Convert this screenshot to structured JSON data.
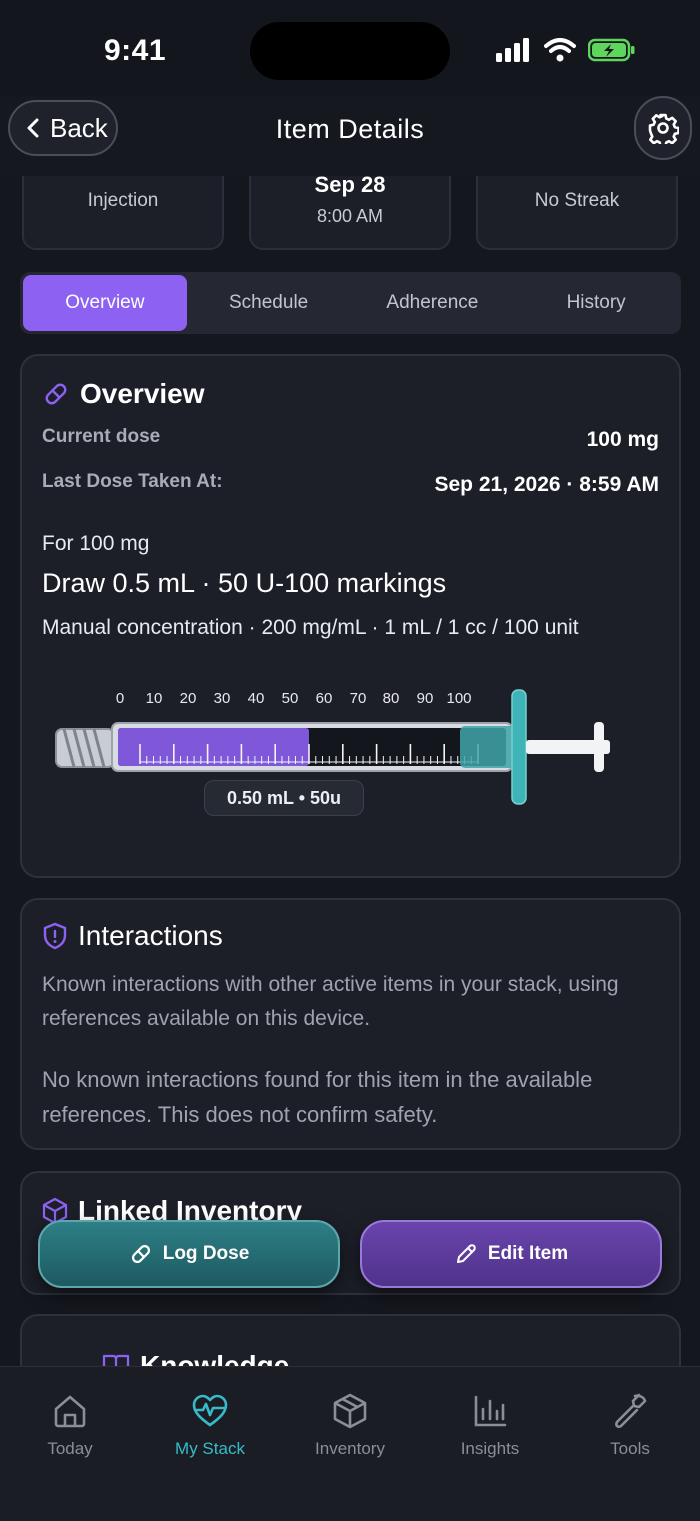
{
  "status_bar": {
    "time": "9:41"
  },
  "header": {
    "back_label": "Back",
    "title": "Item Details"
  },
  "stat_cards": [
    {
      "label": "Injection"
    },
    {
      "title": "Sep 28",
      "subtitle": "8:00 AM"
    },
    {
      "label": "No Streak"
    }
  ],
  "tabs": [
    {
      "label": "Overview",
      "active": true
    },
    {
      "label": "Schedule",
      "active": false
    },
    {
      "label": "Adherence",
      "active": false
    },
    {
      "label": "History",
      "active": false
    }
  ],
  "overview": {
    "title": "Overview",
    "current_dose_label": "Current dose",
    "current_dose_value": "100 mg",
    "last_dose_label": "Last Dose Taken At:",
    "last_dose_value": "Sep 21, 2026 · 8:59 AM",
    "for_dose": "For 100 mg",
    "draw_instruction": "Draw 0.5 mL · 50 U-100 markings",
    "concentration": "Manual concentration · 200 mg/mL · 1 mL / 1 cc / 100 unit",
    "syringe_scale": [
      "0",
      "10",
      "20",
      "30",
      "40",
      "50",
      "60",
      "70",
      "80",
      "90",
      "100"
    ],
    "syringe_fill_fraction": 0.5,
    "dose_pill": "0.50 mL • 50u"
  },
  "interactions": {
    "title": "Interactions",
    "description": "Known interactions with other active items in your stack, using references available on this device.",
    "result": "No known interactions found for this item in the available references. This does not confirm safety."
  },
  "linked_inventory": {
    "title": "Linked Inventory"
  },
  "knowledge": {
    "title": "Knowledge"
  },
  "actions": {
    "log_dose": "Log Dose",
    "edit_item": "Edit Item"
  },
  "tabbar": [
    {
      "label": "Today",
      "icon": "home-icon",
      "active": false
    },
    {
      "label": "My Stack",
      "icon": "heart-pulse-icon",
      "active": true
    },
    {
      "label": "Inventory",
      "icon": "box-icon",
      "active": false
    },
    {
      "label": "Insights",
      "icon": "bar-chart-icon",
      "active": false
    },
    {
      "label": "Tools",
      "icon": "wrench-icon",
      "active": false
    }
  ],
  "colors": {
    "accent_purple": "#8d61f2",
    "accent_teal": "#36bcc8",
    "background": "#15171f",
    "card": "#1c1f28"
  }
}
